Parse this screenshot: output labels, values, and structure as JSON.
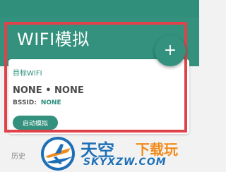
{
  "app_bar": {
    "title": "WIFI模拟"
  },
  "fab": {
    "icon": "plus-icon",
    "glyph": "+"
  },
  "card": {
    "subtitle": "目标WIFI",
    "wifi_name": "NONE • NONE",
    "bssid_label": "BSSID:",
    "bssid_value": "NONE",
    "start_button_label": "启动模拟"
  },
  "history": {
    "label": "历史"
  },
  "watermark": {
    "title_part1": "天空",
    "title_part2": "下载玩",
    "url": "SKYXZW.COM"
  },
  "colors": {
    "primary": "#33917d",
    "accent_text": "#2a8f7c",
    "highlight_border": "#e0424a",
    "watermark_blue": "#1e6fb5",
    "watermark_orange": "#f08a1c"
  }
}
